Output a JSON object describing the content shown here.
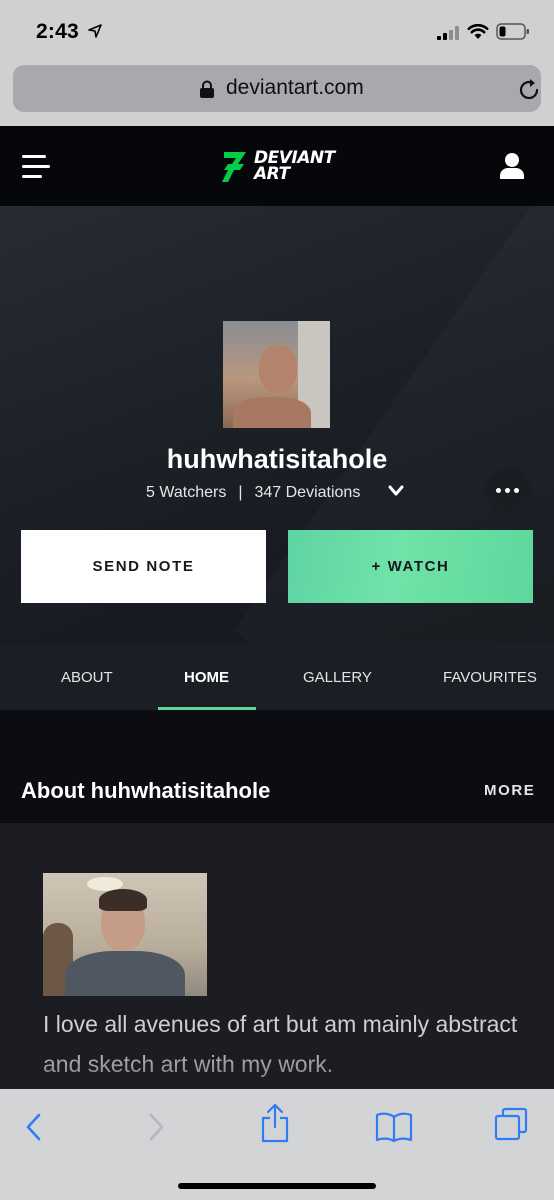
{
  "status_bar": {
    "time": "2:43"
  },
  "browser": {
    "url": "deviantart.com"
  },
  "header": {
    "logo_text_line1": "DEVIANT",
    "logo_text_line2": "ART"
  },
  "profile": {
    "username": "huhwhatisitahole",
    "watchers": "5 Watchers",
    "separator": "|",
    "deviations": "347 Deviations"
  },
  "actions": {
    "send_note": "SEND NOTE",
    "watch": "+ WATCH"
  },
  "tabs": [
    {
      "label": "ABOUT"
    },
    {
      "label": "HOME"
    },
    {
      "label": "GALLERY"
    },
    {
      "label": "FAVOURITES"
    }
  ],
  "active_tab": "HOME",
  "about": {
    "title": "About huhwhatisitahole",
    "more_label": "MORE",
    "text": "I love all avenues of art but am mainly abstract and sketch art with my work."
  },
  "colors": {
    "accent_green": "#5ed79c",
    "header_bg": "#06070a",
    "ios_blue": "#2f7cf6"
  }
}
